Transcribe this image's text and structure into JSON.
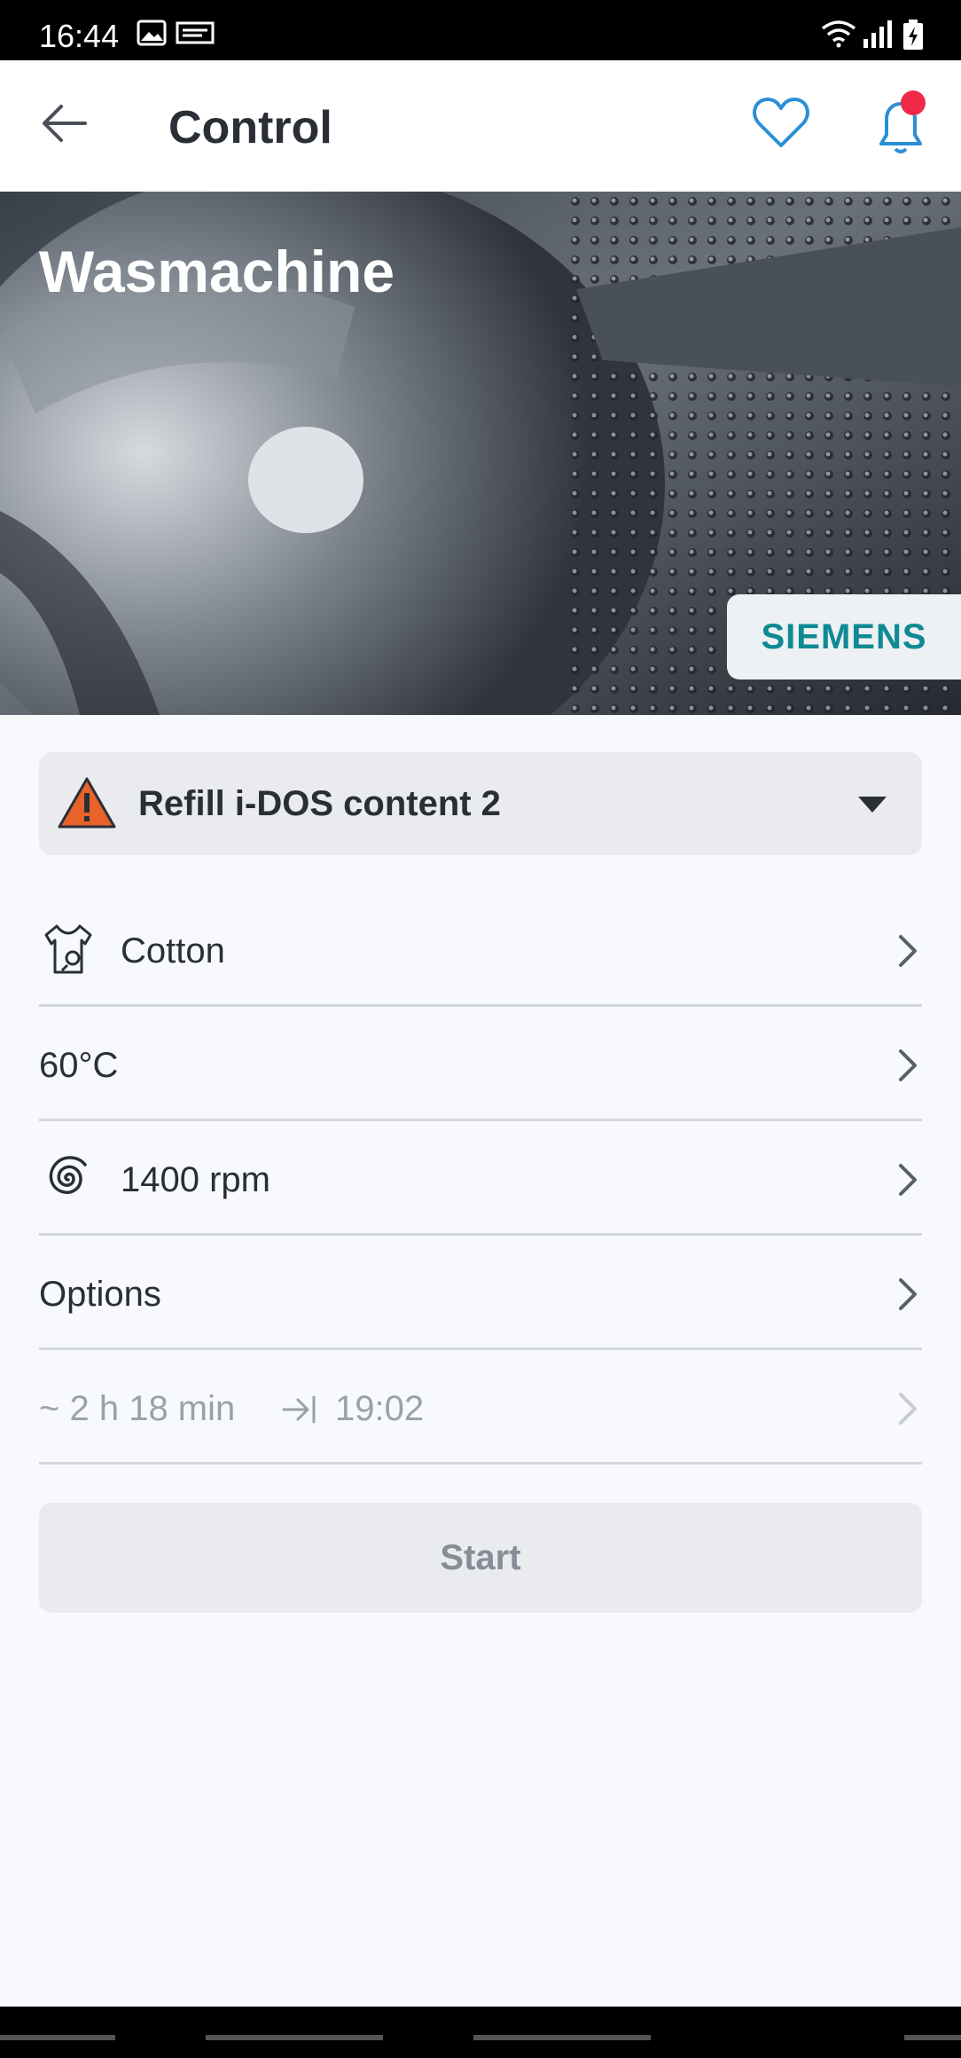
{
  "status_bar": {
    "time": "16:44",
    "icons": [
      "image-icon",
      "rtl-nieuws-icon",
      "wifi-icon",
      "signal-icon",
      "battery-icon"
    ]
  },
  "app_bar": {
    "title": "Control",
    "back_icon": "arrow-left-icon",
    "favorite_icon": "heart-icon",
    "notification_icon": "bell-icon"
  },
  "hero": {
    "title": "Wasmachine",
    "brand": "SIEMENS"
  },
  "alert": {
    "text": "Refill i-DOS content 2",
    "icon": "warning-icon"
  },
  "settings": {
    "program": "Cotton",
    "temperature": "60°C",
    "spin": "1400 rpm",
    "options": "Options",
    "duration": "~ 2 h 18 min",
    "finish_time": "19:02"
  },
  "start_button": "Start",
  "colors": {
    "accent": "#2a8fd6",
    "brand": "#0f8a94",
    "warning": "#e8632a",
    "notification_dot": "#ef2947"
  }
}
